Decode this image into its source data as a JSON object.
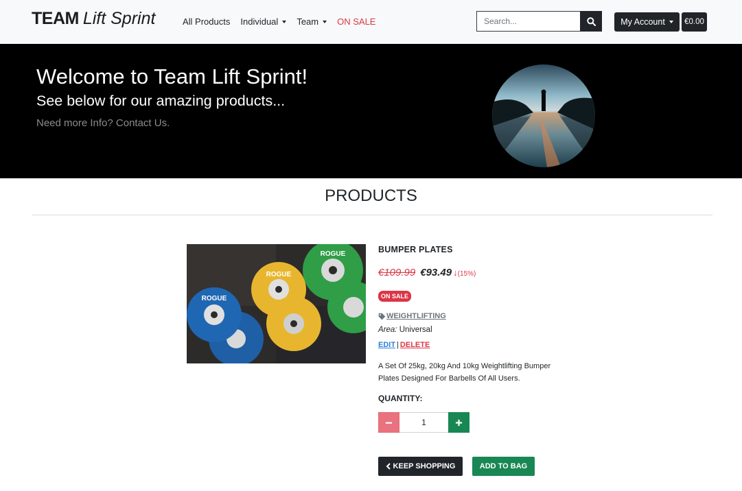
{
  "brand": {
    "team": "TEAM",
    "name": "Lift Sprint"
  },
  "nav": {
    "items": [
      {
        "label": "All Products",
        "dropdown": false
      },
      {
        "label": "Individual",
        "dropdown": true
      },
      {
        "label": "Team",
        "dropdown": true
      },
      {
        "label": "ON SALE",
        "dropdown": false
      }
    ],
    "search_placeholder": "Search...",
    "account_label": "My Account",
    "bag_total": "€0.00"
  },
  "hero": {
    "title": "Welcome to Team Lift Sprint!",
    "subtitle": "See below for our amazing products...",
    "contact": "Need more Info? Contact Us."
  },
  "section": {
    "title": "PRODUCTS"
  },
  "product": {
    "name": "BUMPER PLATES",
    "old_price": "€109.99",
    "new_price": "€93.49",
    "discount": "(15%)",
    "badge": "ON SALE",
    "category": "WEIGHTLIFTING",
    "area_label": "Area:",
    "area_value": "Universal",
    "edit_label": "EDIT",
    "separator": "|",
    "delete_label": "DELETE",
    "description": "A Set Of 25kg, 20kg And 10kg Weightlifting Bumper Plates Designed For Barbells Of All Users.",
    "quantity_label": "QUANTITY:",
    "quantity_value": "1",
    "plate_text": "ROGUE"
  },
  "actions": {
    "keep_shopping": "KEEP SHOPPING",
    "add_to_bag": "ADD TO BAG"
  },
  "colors": {
    "sale": "#dc3545",
    "success": "#198754",
    "dark": "#212529",
    "navbar_bg": "#f8f9fa"
  }
}
